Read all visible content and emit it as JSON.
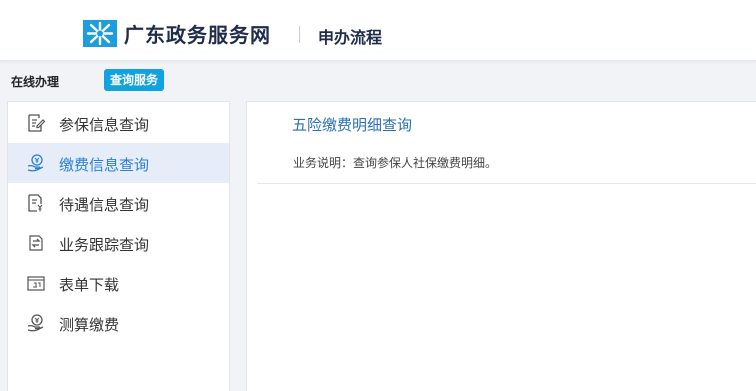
{
  "header": {
    "site_title": "广东政务服务网",
    "section_title": "申办流程"
  },
  "tabs": {
    "online": "在线办理",
    "query": "查询服务"
  },
  "sidebar": {
    "items": [
      {
        "label": "参保信息查询",
        "icon": "document-edit-icon"
      },
      {
        "label": "缴费信息查询",
        "icon": "money-hand-icon",
        "active": true
      },
      {
        "label": "待遇信息查询",
        "icon": "document-yen-icon"
      },
      {
        "label": "业务跟踪查询",
        "icon": "swap-arrows-icon"
      },
      {
        "label": "表单下载",
        "icon": "form-download-icon"
      },
      {
        "label": "测算缴费",
        "icon": "money-hand-icon"
      }
    ]
  },
  "main": {
    "title": "五险缴费明细查询",
    "description": "业务说明：查询参保人社保缴费明细。"
  },
  "colors": {
    "accent": "#11a2e2",
    "link": "#2b6fb8",
    "active_bg": "#e6edf9"
  }
}
